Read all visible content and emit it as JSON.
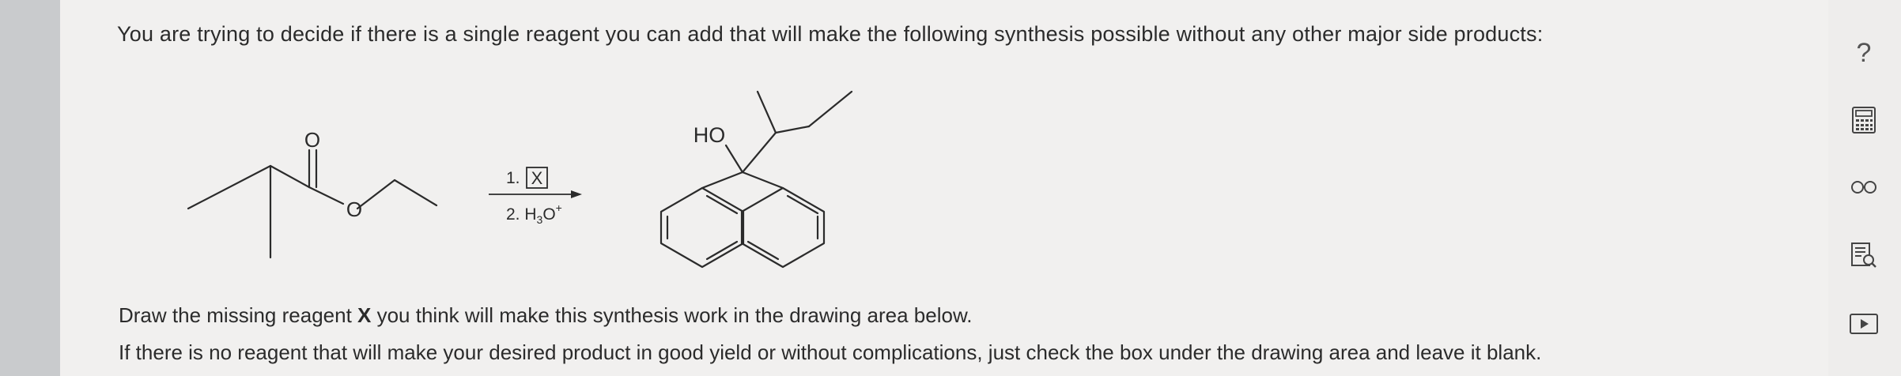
{
  "question": {
    "prompt": "You are trying to decide if there is a single reagent you can add that will make the following synthesis possible without any other major side products:",
    "instruction_prefix": "Draw the missing reagent ",
    "instruction_bold": "X",
    "instruction_suffix": " you think will make this synthesis work in the drawing area below.",
    "note": "If there is no reagent that will make your desired product in good yield or without complications, just check the box under the drawing area and leave it blank."
  },
  "reaction": {
    "reactant_atoms": {
      "carbonyl_o": "O",
      "ester_o": "O"
    },
    "step1_number": "1.",
    "step1_reagent": "X",
    "step2_label": "2. H",
    "step2_sub": "3",
    "step2_o": "O",
    "step2_sup": "+",
    "product_label": "HO"
  },
  "toolbar": {
    "help": "?",
    "icons": [
      "calculator-icon",
      "glasses-icon",
      "reference-icon",
      "video-icon"
    ]
  }
}
